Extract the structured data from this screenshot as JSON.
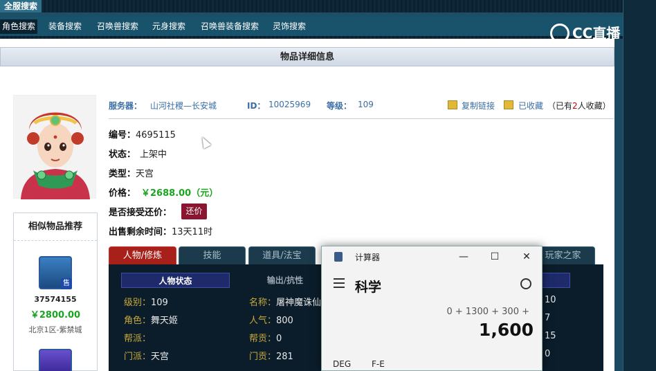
{
  "top_title": "全服搜索",
  "nav": [
    {
      "label": "角色搜索",
      "active": true
    },
    {
      "label": "装备搜索",
      "active": false
    },
    {
      "label": "召唤兽搜索",
      "active": false
    },
    {
      "label": "元身搜索",
      "active": false
    },
    {
      "label": "召唤兽装备搜索",
      "active": false
    },
    {
      "label": "灵饰搜索",
      "active": false
    }
  ],
  "logo": {
    "text": "CC直播"
  },
  "section_title": "物品详细信息",
  "info": {
    "server_label": "服务器：",
    "server_value": "山河社稷—长安城",
    "id_label": "ID：",
    "id_value": "10025969",
    "level_label": "等级：",
    "level_value": "109",
    "copy_link": "复制链接",
    "favorited": "已收藏",
    "fav_count_prefix": "（已有",
    "fav_count": "2",
    "fav_count_suffix": "人收藏）"
  },
  "fields": {
    "serial_label": "编号：",
    "serial_value": "4695115",
    "status_label": "状态：",
    "status_value": "上架中",
    "type_label": "类型：",
    "type_value": "天宫",
    "price_label": "价格：",
    "price_value": "￥2688.00（元）",
    "bargain_label": "是否接受还价：",
    "bargain_button": "还价",
    "remaining_label": "出售剩余时间：",
    "remaining_value": "13天11时"
  },
  "similar": {
    "title": "相似物品推荐",
    "items": [
      {
        "id": "37574155",
        "price": "￥2800.00",
        "server": "北京1区-紫禁城",
        "badge": "售"
      }
    ]
  },
  "game_tabs": [
    "人物/修炼",
    "技能",
    "道具/法宝",
    "玩家之家"
  ],
  "sub_tabs": {
    "active": "人物状态",
    "plain": "输出/抗性"
  },
  "stats_left": [
    {
      "k": "级别：",
      "v": "109"
    },
    {
      "k": "角色：",
      "v": "舞天姬"
    },
    {
      "k": "帮派：",
      "v": ""
    },
    {
      "k": "门派：",
      "v": "天宫"
    }
  ],
  "stats_mid": [
    {
      "k": "名称：",
      "v": "屠神魔诛仙"
    },
    {
      "k": "人气：",
      "v": "800"
    },
    {
      "k": "帮贡：",
      "v": "0"
    },
    {
      "k": "门贡：",
      "v": "281"
    }
  ],
  "stats_right": [
    "10",
    "7",
    "15",
    "0"
  ],
  "calculator": {
    "title": "计算器",
    "mode": "科学",
    "expression": "0 + 1300 + 300 +",
    "result": "1,600",
    "opt1": "DEG",
    "opt2": "F-E"
  }
}
